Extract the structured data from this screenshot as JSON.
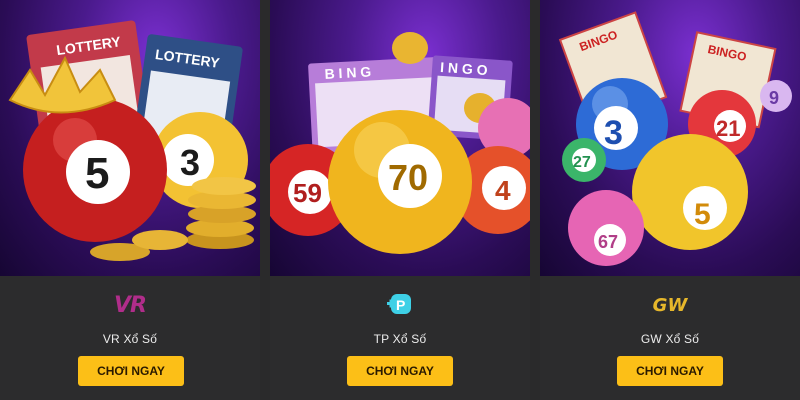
{
  "cards": [
    {
      "brand": "VR",
      "name": "VR Xổ Số",
      "button": "CHƠI NGAY",
      "ticket1": "LOTTERY",
      "ticket2": "LOTTERY",
      "ball_main": "5",
      "ball_side": "3"
    },
    {
      "brand": "P",
      "name": "TP Xổ Số",
      "button": "CHƠI NGAY",
      "card_title1": "B I N G",
      "card_title2": "I N G O",
      "ball_main": "70",
      "ball_left": "59",
      "ball_right": "4"
    },
    {
      "brand": "GW",
      "name": "GW Xổ Số",
      "button": "CHƠI NGAY",
      "card1": "BINGO",
      "card2": "BINGO",
      "ball_blue": "3",
      "ball_red": "21",
      "ball_green": "27",
      "ball_yellow": "5",
      "ball_pink": "67",
      "ball_small": "9"
    }
  ],
  "colors": {
    "button": "#fcbf17",
    "bg": "#2b2b2c",
    "art": "#4a1a8c"
  }
}
